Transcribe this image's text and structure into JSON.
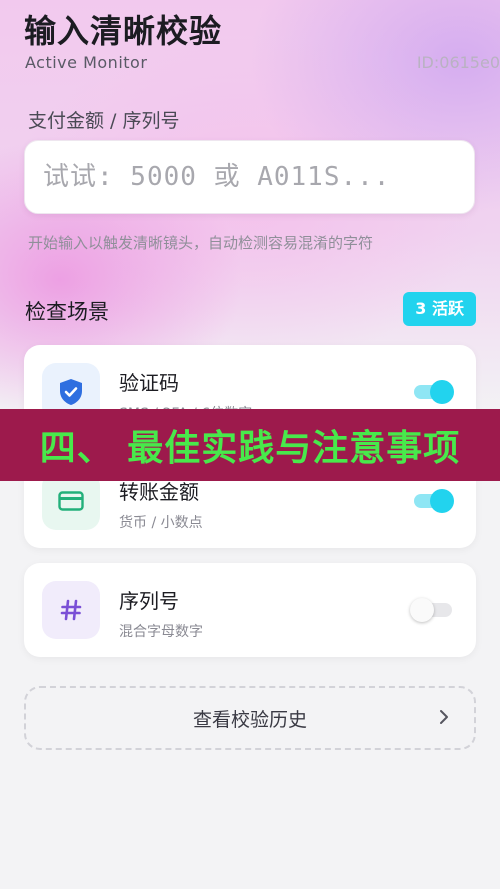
{
  "header": {
    "title": "输入清晰校验",
    "subtitle": "Active Monitor",
    "id_tag": "ID:0615e0"
  },
  "input": {
    "label": "支付金额 / 序列号",
    "placeholder": "试试: 5000 或 A011S...",
    "value": "",
    "hint": "开始输入以触发清晰镜头，自动检测容易混淆的字符"
  },
  "scenes": {
    "title": "检查场景",
    "badge": "3 活跃",
    "items": [
      {
        "name": "验证码",
        "desc": "SMS / 2FA / 6位数字",
        "icon": "shield-check-icon",
        "enabled": true,
        "icon_color": "#2f6fe0",
        "icon_bg": "#eaf2fd"
      },
      {
        "name": "转账金额",
        "desc": "货币 / 小数点",
        "icon": "card-icon",
        "enabled": true,
        "icon_color": "#22b07a",
        "icon_bg": "#e8f7f0"
      },
      {
        "name": "序列号",
        "desc": "混合字母数字",
        "icon": "hash-icon",
        "enabled": false,
        "icon_color": "#7a4fd6",
        "icon_bg": "#f1ecfb"
      }
    ]
  },
  "history": {
    "label": "查看校验历史"
  },
  "banner": {
    "text": "四、 最佳实践与注意事项"
  },
  "colors": {
    "accent": "#22d3ee",
    "banner_bg": "#9d1a4c",
    "banner_text": "#48e94b"
  }
}
